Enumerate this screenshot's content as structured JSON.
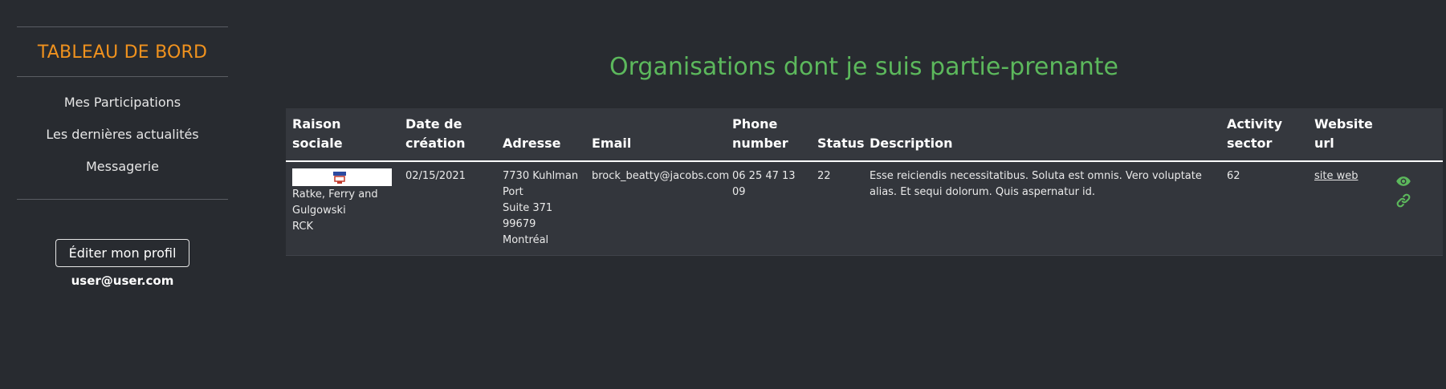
{
  "sidebar": {
    "brand": "TABLEAU DE BORD",
    "nav": [
      {
        "label": "Mes Participations"
      },
      {
        "label": "Les dernières actualités"
      },
      {
        "label": "Messagerie"
      }
    ],
    "edit_profile_label": "Éditer mon profil",
    "user_email": "user@user.com"
  },
  "main": {
    "title": "Organisations dont je suis partie-prenante",
    "table": {
      "headers": {
        "raison_sociale": "Raison sociale",
        "date_creation": "Date de création",
        "adresse": "Adresse",
        "email": "Email",
        "phone": "Phone number",
        "status": "Status",
        "description": "Description",
        "activity": "Activity sector",
        "website": "Website url"
      },
      "rows": [
        {
          "raison_sociale": [
            "Ratke, Ferry and",
            "Gulgowski",
            "RCK"
          ],
          "date_creation": "02/15/2021",
          "adresse": [
            "7730 Kuhlman",
            "Port",
            "Suite 371",
            "99679",
            "Montréal"
          ],
          "email": "brock_beatty@jacobs.com",
          "phone": "06 25 47 13 09",
          "status": "22",
          "description": "Esse reiciendis necessitatibus. Soluta est omnis. Vero voluptate alias. Et sequi dolorum. Quis aspernatur id.",
          "activity": "62",
          "website": "site web",
          "actions": [
            "eye-icon",
            "link-icon"
          ]
        }
      ]
    }
  },
  "colors": {
    "background": "#282b30",
    "brand": "#f0921e",
    "title": "#5cb85c",
    "action": "#5cb85c"
  }
}
